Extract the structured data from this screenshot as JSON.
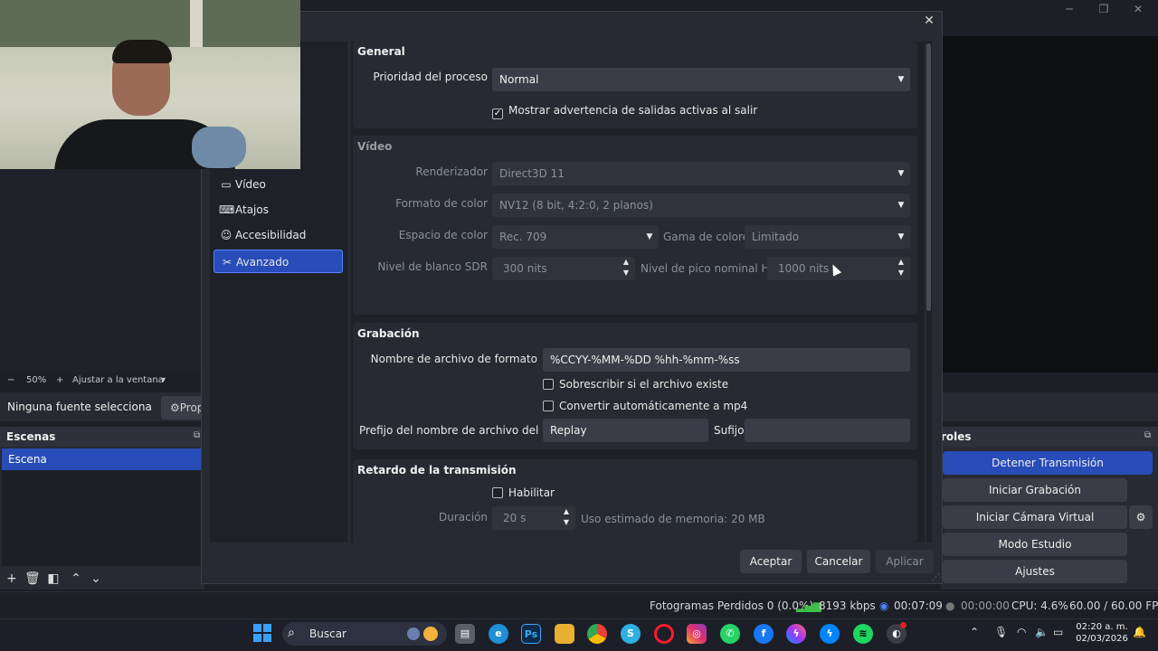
{
  "main": {
    "zoom": {
      "minus": "−",
      "percent": "50%",
      "plus": "+",
      "fit": "Ajustar a la ventana",
      "dropdown": "▾"
    },
    "source_bar": {
      "no_source": "Ninguna fuente selecciona",
      "properties": "Prop"
    },
    "scenes": {
      "title": "Escenas",
      "items": [
        "Escena"
      ]
    },
    "controls": {
      "title": "roles",
      "buttons": [
        "Detener Transmisión",
        "Iniciar Grabación",
        "Iniciar Cámara Virtual",
        "Modo Estudio",
        "Ajustes"
      ]
    },
    "status": {
      "dropped": "Fotogramas Perdidos 0 (0.0%)",
      "bitrate": "8193 kbps",
      "stream_time": "00:07:09",
      "rec_time": "00:00:00",
      "cpu": "CPU: 4.6%",
      "fps": "60.00 / 60.00 FPS"
    }
  },
  "dialog": {
    "close": "✕",
    "sidebar": [
      {
        "label": "Vídeo",
        "icon": "monitor-icon"
      },
      {
        "label": "Atajos",
        "icon": "keyboard-icon"
      },
      {
        "label": "Accesibilidad",
        "icon": "accessibility-icon"
      },
      {
        "label": "Avanzado",
        "icon": "tools-icon",
        "active": true
      }
    ],
    "general": {
      "title": "General",
      "priority_label": "Prioridad del proceso",
      "priority_value": "Normal",
      "warn_checkbox": "Mostrar advertencia de salidas activas al salir",
      "warn_checked": true
    },
    "video": {
      "title": "Vídeo",
      "renderer_label": "Renderizador",
      "renderer_value": "Direct3D 11",
      "color_format_label": "Formato de color",
      "color_format_value": "NV12 (8 bit, 4:2:0, 2 planos)",
      "color_space_label": "Espacio de color",
      "color_space_value": "Rec. 709",
      "color_range_label": "Gama de colores",
      "color_range_value": "Limitado",
      "sdr_white_label": "Nivel de blanco SDR",
      "sdr_white_value": "300 nits",
      "hdr_peak_label": "Nivel de pico nominal HDR",
      "hdr_peak_value": "1000 nits"
    },
    "recording": {
      "title": "Grabación",
      "filename_label": "Nombre de archivo de formato",
      "filename_value": "%CCYY-%MM-%DD %hh-%mm-%ss",
      "overwrite_checkbox": "Sobrescribir si el archivo existe",
      "remux_checkbox": "Convertir automáticamente a mp4",
      "buffer_prefix_label": "Prefijo del nombre de archivo del búfer",
      "buffer_prefix_value": "Replay",
      "suffix_label": "Sufijo",
      "suffix_value": ""
    },
    "delay": {
      "title": "Retardo de la transmisión",
      "enable_checkbox": "Habilitar",
      "duration_label": "Duración",
      "duration_value": "20 s",
      "memory_note": "Uso estimado de memoria: 20 MB"
    },
    "buttons": {
      "ok": "Aceptar",
      "cancel": "Cancelar",
      "apply": "Aplicar"
    }
  },
  "taskbar": {
    "search_placeholder": "Buscar",
    "apps": [
      "file-explorer",
      "edge",
      "photoshop",
      "folder",
      "chrome",
      "skype",
      "opera",
      "instagram",
      "whatsapp",
      "facebook",
      "messenger",
      "messenger-alt",
      "spotify",
      "obs"
    ],
    "clock_time": "02:20 a. m.",
    "clock_date": "02/03/2026"
  },
  "colors": {
    "accent": "#284cb8",
    "panel": "#272a33",
    "field": "#3a3d47",
    "bg": "#1d1f26"
  }
}
